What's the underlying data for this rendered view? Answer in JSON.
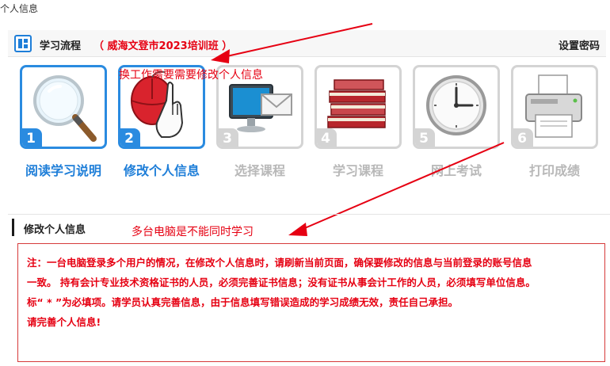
{
  "breadcrumb": "个人信息",
  "flow": {
    "title": "学习流程",
    "class_name": "（ 威海文登市2023培训班 ）",
    "settings_link": "设置密码"
  },
  "steps": [
    {
      "number": "1",
      "label": "阅读学习说明",
      "state": "active",
      "icon": "magnifier-icon"
    },
    {
      "number": "2",
      "label": "修改个人信息",
      "state": "active",
      "icon": "mouse-hand-icon"
    },
    {
      "number": "3",
      "label": "选择课程",
      "state": "disabled",
      "icon": "monitor-mail-icon"
    },
    {
      "number": "4",
      "label": "学习课程",
      "state": "disabled",
      "icon": "books-icon"
    },
    {
      "number": "5",
      "label": "网上考试",
      "state": "disabled",
      "icon": "clock-icon"
    },
    {
      "number": "6",
      "label": "打印成绩",
      "state": "disabled",
      "icon": "printer-icon"
    }
  ],
  "annotations": {
    "top": "换工作需要需要修改个人信息",
    "middle": "多台电脑是不能同时学习"
  },
  "info": {
    "title": "修改个人信息",
    "notice_lines": [
      "注：一台电脑登录多个用户的情况，在修改个人信息时，请刷新当前页面，确保要修改的信息与当前登录的账号信息",
      "一致。 持有会计专业技术资格证书的人员，必须完善证书信息；没有证书从事会计工作的人员，必须填写单位信息。",
      "标“ * ”为必填项。请学员认真完善信息，由于信息填写错误造成的学习成绩无效，责任自己承担。",
      "请完善个人信息!"
    ]
  },
  "colors": {
    "accent": "#2a8be0",
    "annotation": "#e60012",
    "disabled": "#d4d4d4"
  }
}
